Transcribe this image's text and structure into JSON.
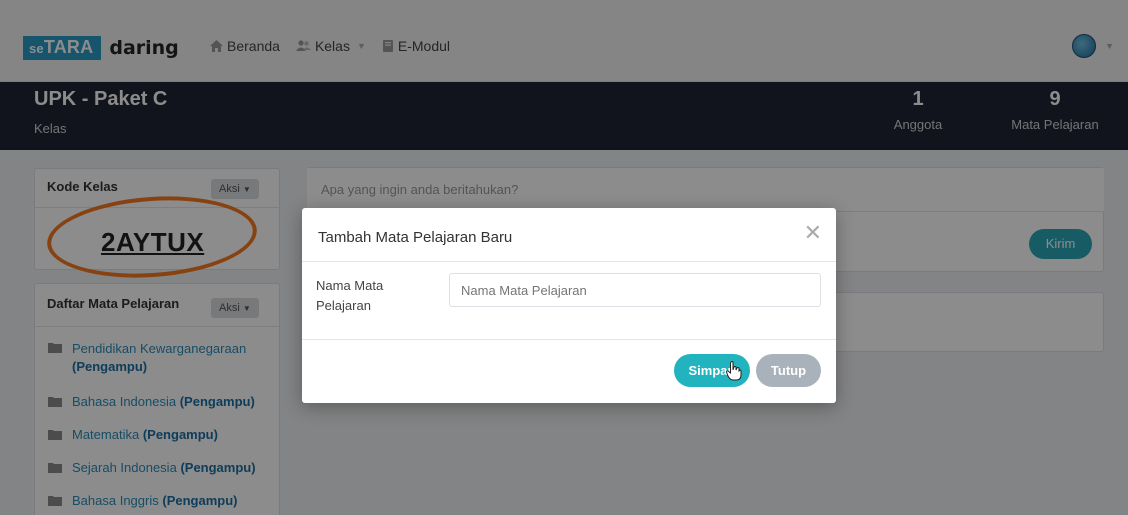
{
  "app": {
    "logo_prefix": "se",
    "logo_box": "TARA",
    "logo_word": "daring"
  },
  "nav": {
    "items": [
      {
        "label": "Beranda",
        "icon": "home-icon"
      },
      {
        "label": "Kelas",
        "icon": "users-icon",
        "dropdown": true
      },
      {
        "label": "E-Modul",
        "icon": "book-icon"
      }
    ],
    "avatar_icon": "user-avatar-icon"
  },
  "header": {
    "title": "UPK - Paket C",
    "subtitle": "Kelas",
    "stats": [
      {
        "value": "1",
        "label": "Anggota"
      },
      {
        "value": "9",
        "label": "Mata Pelajaran"
      }
    ]
  },
  "sidebar": {
    "kode": {
      "heading": "Kode Kelas",
      "aksi_label": "Aksi",
      "code": "2AYTUX"
    },
    "mapel": {
      "heading": "Daftar Mata Pelajaran",
      "aksi_label": "Aksi",
      "items": [
        {
          "name": "Pendidikan Kewarganegaraan",
          "role": "(Pengampu)"
        },
        {
          "name": "Bahasa Indonesia",
          "role": "(Pengampu)"
        },
        {
          "name": "Matematika",
          "role": "(Pengampu)"
        },
        {
          "name": "Sejarah Indonesia",
          "role": "(Pengampu)"
        },
        {
          "name": "Bahasa Inggris",
          "role": "(Pengampu)"
        }
      ]
    }
  },
  "feed": {
    "placeholder": "Apa yang ingin anda beritahukan?",
    "send_label": "Kirim"
  },
  "modal": {
    "title": "Tambah Mata Pelajaran Baru",
    "close_icon": "close-icon",
    "field_label_line1": "Nama Mata",
    "field_label_line2": "Pelajaran",
    "field_placeholder": "Nama Mata Pelajaran",
    "save_label": "Simpan",
    "close_label": "Tutup"
  },
  "colors": {
    "header_bg": "#1f2633",
    "accent": "#21b3be",
    "logo_blue": "#2a9cc7",
    "highlight_ring": "#f47a20"
  }
}
